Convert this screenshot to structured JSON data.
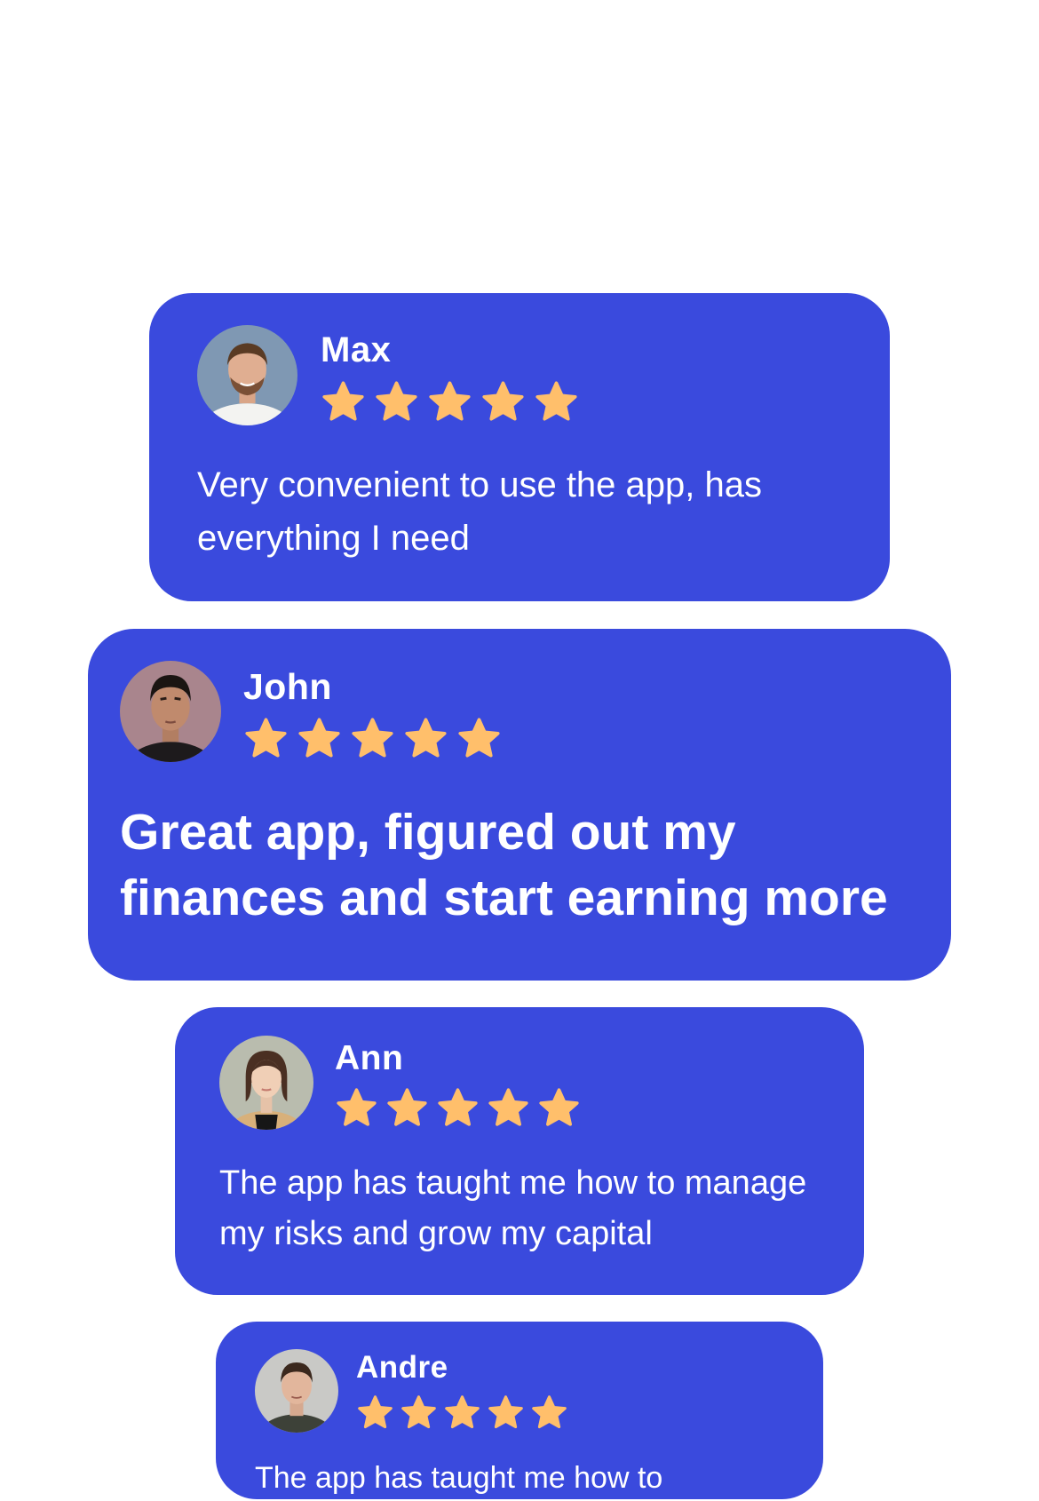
{
  "colors": {
    "background": "#ffffff",
    "card": "#3a4add",
    "text": "#ffffff",
    "star": "#ffbf6b"
  },
  "reviews": [
    {
      "name": "Max",
      "rating": 5,
      "text": "Very convenient to use the app, has everything I need",
      "avatar_icon": "user-avatar"
    },
    {
      "name": "John",
      "rating": 5,
      "text": "Great app, figured out my finances and start earning more",
      "avatar_icon": "user-avatar"
    },
    {
      "name": "Ann",
      "rating": 5,
      "text": "The app has taught me how to manage  my risks and grow my capital",
      "avatar_icon": "user-avatar"
    },
    {
      "name": "Andre",
      "rating": 5,
      "text": "The app has taught me how to",
      "avatar_icon": "user-avatar"
    }
  ]
}
